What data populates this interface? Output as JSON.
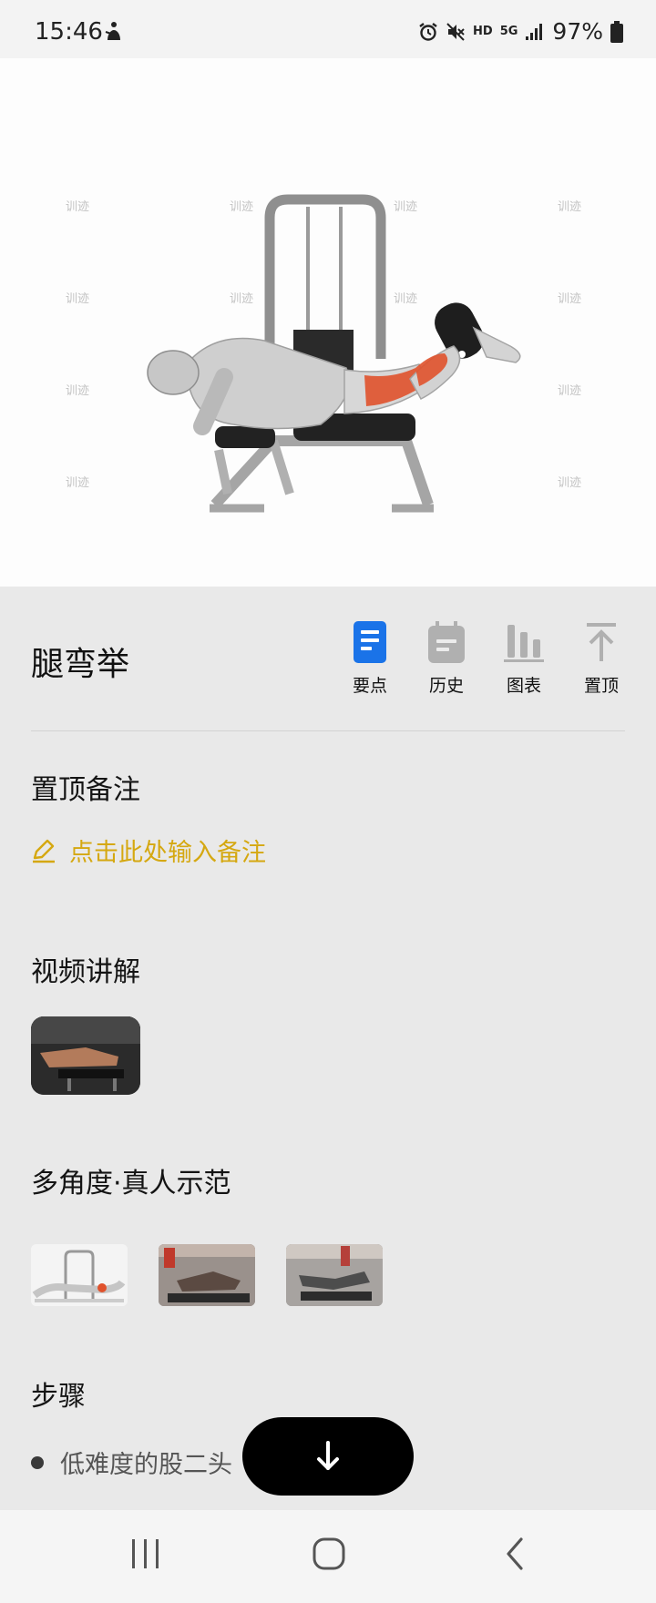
{
  "status_bar": {
    "time": "15:46",
    "network_hd": "HD",
    "network_5g": "5G",
    "battery": "97%",
    "icons": [
      "accessibility-icon",
      "alarm-icon",
      "mute-icon",
      "signal-icon",
      "battery-icon"
    ]
  },
  "hero": {
    "watermark": "训迹"
  },
  "exercise": {
    "title": "腿弯举"
  },
  "tabs": [
    {
      "label": "要点",
      "icon": "key-points-icon",
      "active": true
    },
    {
      "label": "历史",
      "icon": "calendar-icon",
      "active": false
    },
    {
      "label": "图表",
      "icon": "bar-chart-icon",
      "active": false
    },
    {
      "label": "置顶",
      "icon": "pin-to-top-icon",
      "active": false
    }
  ],
  "pinned_note": {
    "heading": "置顶备注",
    "placeholder": "点击此处输入备注"
  },
  "video": {
    "heading": "视频讲解"
  },
  "demos": {
    "heading": "多角度·真人示范"
  },
  "steps": {
    "heading": "步骤",
    "items": [
      "低难度的股二头"
    ]
  },
  "colors": {
    "accent_blue": "#1a73e8",
    "note_yellow": "#d5a811",
    "muscle_red": "#e0522c"
  }
}
